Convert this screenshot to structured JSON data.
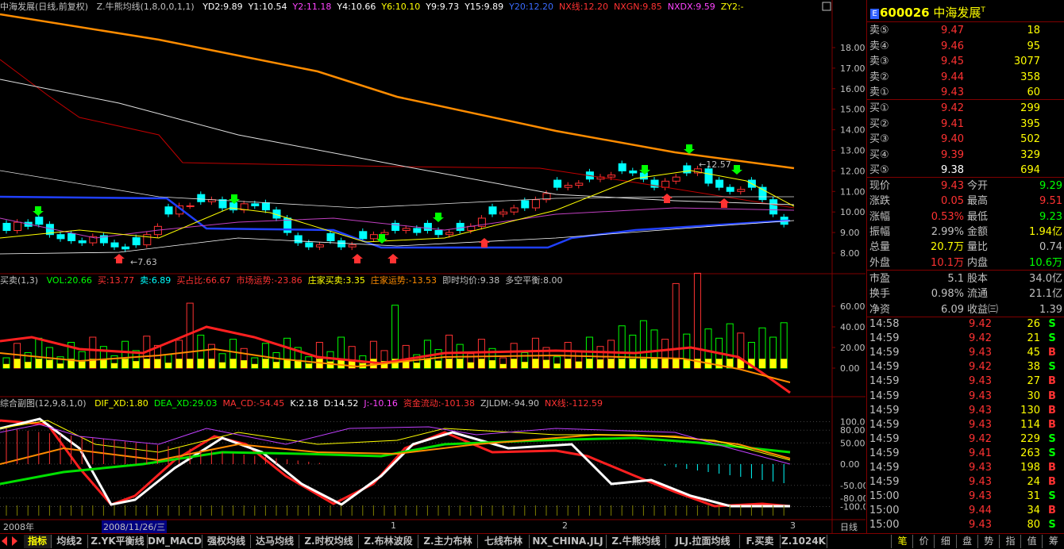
{
  "main_header": {
    "title": "中海发展(日线,前复权)",
    "indicator": "Z.牛熊均线(1,8,0,0,1,1)",
    "items": [
      {
        "label": "YD2:9.89",
        "color": "#ffffff"
      },
      {
        "label": "Y1:10.54",
        "color": "#ffffff"
      },
      {
        "label": "Y2:11.18",
        "color": "#ff44ff"
      },
      {
        "label": "Y4:10.66",
        "color": "#ffffff"
      },
      {
        "label": "Y6:10.10",
        "color": "#ffff00"
      },
      {
        "label": "Y9:9.73",
        "color": "#ffffff"
      },
      {
        "label": "Y15:9.89",
        "color": "#ffffff"
      },
      {
        "label": "Y20:12.20",
        "color": "#3a6bff"
      },
      {
        "label": "NX线:12.20",
        "color": "#ff3232"
      },
      {
        "label": "NXGN:9.85",
        "color": "#ff3232"
      },
      {
        "label": "NXDX:9.59",
        "color": "#ff44ff"
      },
      {
        "label": "ZY2:-",
        "color": "#ffff00"
      }
    ]
  },
  "main_axis": [
    "18.00",
    "17.00",
    "16.00",
    "15.00",
    "14.00",
    "13.00",
    "12.00",
    "11.00",
    "10.00",
    "9.00",
    "8.00"
  ],
  "main_annotations": {
    "high": "12.57",
    "low": "7.63"
  },
  "vol_header": {
    "title": "买卖(1,3)",
    "items": [
      {
        "label": "VOL:20.66",
        "color": "#00ff00"
      },
      {
        "label": "买:13.77",
        "color": "#ff3232"
      },
      {
        "label": "卖:6.89",
        "color": "#00ffff"
      },
      {
        "label": "买占比:66.67",
        "color": "#ff3232"
      },
      {
        "label": "市场运势:-23.86",
        "color": "#ff3232"
      },
      {
        "label": "庄家买卖:3.35",
        "color": "#ffff00"
      },
      {
        "label": "庄家运势:-13.53",
        "color": "#ff8c00"
      },
      {
        "label": "即时均价:9.38",
        "color": "#c0c0c0"
      },
      {
        "label": "多空平衡:8.00",
        "color": "#c0c0c0"
      }
    ]
  },
  "vol_axis": [
    "60.00",
    "40.00",
    "20.00",
    "0.00"
  ],
  "sub_header": {
    "title": "综合副图(12,9,8,1,0)",
    "items": [
      {
        "label": "DIF_XD:1.80",
        "color": "#ffff00"
      },
      {
        "label": "DEA_XD:29.03",
        "color": "#00ff00"
      },
      {
        "label": "MA_CD:-54.45",
        "color": "#ff3232"
      },
      {
        "label": "K:2.18",
        "color": "#ffffff"
      },
      {
        "label": "D:14.52",
        "color": "#ffffff"
      },
      {
        "label": "J:-10.16",
        "color": "#ff44ff"
      },
      {
        "label": "资金流动:-101.38",
        "color": "#ff3232"
      },
      {
        "label": "ZJLDM:-94.90",
        "color": "#c0c0c0"
      },
      {
        "label": "NX线:-112.59",
        "color": "#ff3232"
      }
    ]
  },
  "sub_axis": [
    "100.00",
    "80.00",
    "50.00",
    "0.00",
    "-50.00",
    "-80.00",
    "-100.00"
  ],
  "time_axis": {
    "year": "2008年",
    "cursor": "2008/11/26/三",
    "ticks": [
      "1",
      "2",
      "3"
    ],
    "period": "日线"
  },
  "stock": {
    "code": "600026",
    "name": "中海发展",
    "badge": "E",
    "suffix": "T"
  },
  "asks": [
    {
      "label": "卖⑤",
      "price": "9.47",
      "vol": "18"
    },
    {
      "label": "卖④",
      "price": "9.46",
      "vol": "95"
    },
    {
      "label": "卖③",
      "price": "9.45",
      "vol": "3077"
    },
    {
      "label": "卖②",
      "price": "9.44",
      "vol": "358"
    },
    {
      "label": "卖①",
      "price": "9.43",
      "vol": "60"
    }
  ],
  "bids": [
    {
      "label": "买①",
      "price": "9.42",
      "vol": "299"
    },
    {
      "label": "买②",
      "price": "9.41",
      "vol": "395"
    },
    {
      "label": "买③",
      "price": "9.40",
      "vol": "502"
    },
    {
      "label": "买④",
      "price": "9.39",
      "vol": "329"
    },
    {
      "label": "买⑤",
      "price": "9.38",
      "vol": "694"
    }
  ],
  "stats1": [
    {
      "l1": "现价",
      "v1": "9.43",
      "c1": "#ff3232",
      "l2": "今开",
      "v2": "9.29",
      "c2": "#00ff00"
    },
    {
      "l1": "涨跌",
      "v1": "0.05",
      "c1": "#ff3232",
      "l2": "最高",
      "v2": "9.51",
      "c2": "#ff3232"
    },
    {
      "l1": "涨幅",
      "v1": "0.53%",
      "c1": "#ff3232",
      "l2": "最低",
      "v2": "9.23",
      "c2": "#00ff00"
    },
    {
      "l1": "振幅",
      "v1": "2.99%",
      "c1": "#c0c0c0",
      "l2": "金额",
      "v2": "1.94亿",
      "c2": "#ffff00"
    },
    {
      "l1": "总量",
      "v1": "20.7万",
      "c1": "#ffff00",
      "l2": "量比",
      "v2": "0.74",
      "c2": "#c0c0c0"
    },
    {
      "l1": "外盘",
      "v1": "10.1万",
      "c1": "#ff3232",
      "l2": "内盘",
      "v2": "10.6万",
      "c2": "#00ff00"
    }
  ],
  "stats2": [
    {
      "l1": "市盈",
      "v1": "5.1",
      "c1": "#c0c0c0",
      "l2": "股本",
      "v2": "34.0亿",
      "c2": "#c0c0c0"
    },
    {
      "l1": "换手",
      "v1": "0.98%",
      "c1": "#c0c0c0",
      "l2": "流通",
      "v2": "21.1亿",
      "c2": "#c0c0c0"
    },
    {
      "l1": "净资",
      "v1": "6.09",
      "c1": "#c0c0c0",
      "l2": "收益㈢",
      "v2": "1.39",
      "c2": "#c0c0c0"
    }
  ],
  "ticks": [
    {
      "time": "14:58",
      "price": "9.42",
      "vol": "26",
      "side": "S"
    },
    {
      "time": "14:59",
      "price": "9.42",
      "vol": "21",
      "side": "S"
    },
    {
      "time": "14:59",
      "price": "9.43",
      "vol": "45",
      "side": "B"
    },
    {
      "time": "14:59",
      "price": "9.42",
      "vol": "38",
      "side": "S"
    },
    {
      "time": "14:59",
      "price": "9.43",
      "vol": "27",
      "side": "B"
    },
    {
      "time": "14:59",
      "price": "9.43",
      "vol": "30",
      "side": "B"
    },
    {
      "time": "14:59",
      "price": "9.43",
      "vol": "130",
      "side": "B"
    },
    {
      "time": "14:59",
      "price": "9.43",
      "vol": "114",
      "side": "B"
    },
    {
      "time": "14:59",
      "price": "9.42",
      "vol": "229",
      "side": "S"
    },
    {
      "time": "14:59",
      "price": "9.41",
      "vol": "263",
      "side": "S"
    },
    {
      "time": "14:59",
      "price": "9.43",
      "vol": "198",
      "side": "B"
    },
    {
      "time": "14:59",
      "price": "9.43",
      "vol": "24",
      "side": "B"
    },
    {
      "time": "15:00",
      "price": "9.43",
      "vol": "31",
      "side": "S"
    },
    {
      "time": "15:00",
      "price": "9.44",
      "vol": "34",
      "side": "B"
    },
    {
      "time": "15:00",
      "price": "9.43",
      "vol": "80",
      "side": "S"
    }
  ],
  "bottom_tabs": [
    "指标",
    "均线2",
    "Z.YK平衡线",
    "DM_MACD",
    "强权均线",
    "达马均线",
    "Z.时权均线",
    "Z.布林波段",
    "Z.主力布林",
    "七线布林",
    "NX_CHINA.JLJ",
    "Z.牛熊均线",
    "JLJ.拉面均线",
    "F.买卖",
    "Z.1024K"
  ],
  "right_tabs": [
    "笔",
    "价",
    "细",
    "盘",
    "势",
    "指",
    "值",
    "筹"
  ],
  "colors": {
    "up": "#ff3232",
    "down": "#00ffff",
    "vol_up": "#ff3232",
    "vol_down": "#00ff00",
    "grid": "#800000",
    "buy": "#ff3232",
    "sell": "#00ff00"
  }
}
